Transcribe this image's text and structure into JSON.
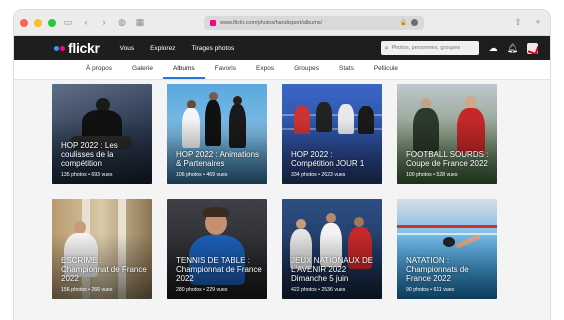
{
  "browser": {
    "url": "www.flickr.com/photos/handisport/albums/"
  },
  "header": {
    "logo_text": "flickr",
    "nav": [
      "Vous",
      "Explorez",
      "Tirages photos"
    ],
    "search_placeholder": "Photos, personnes, groupes"
  },
  "tabs": {
    "items": [
      "À propos",
      "Galerie",
      "Albums",
      "Favoris",
      "Expos",
      "Groupes",
      "Stats",
      "Pellicule"
    ],
    "active": "Albums"
  },
  "albums": [
    {
      "title": "HOP 2022 : Les coulisses de la compétition",
      "meta": "135 photos  •  693 vues"
    },
    {
      "title": "HOP 2022 : Animations & Partenaires",
      "meta": "106 photos  •  469 vues"
    },
    {
      "title": "HOP 2022 : Compétition JOUR 1",
      "meta": "334 photos  •  2623 vues"
    },
    {
      "title": "FOOTBALL SOURDS : Coupe de France 2022",
      "meta": "100 photos  •  528 vues"
    },
    {
      "title": "ESCRIME : Championnat de France 2022",
      "meta": "156 photos  •  266 vues"
    },
    {
      "title": "TENNIS DE TABLE : Championnat de France 2022",
      "meta": "280 photos  •  229 vues"
    },
    {
      "title": "JEUX NATIONAUX DE L'AVENIR 2022 Dimanche 5 juin",
      "meta": "422 photos  •  2536 vues"
    },
    {
      "title": "NATATION : Championnats de France 2022",
      "meta": "90 photos  •  611 vues"
    }
  ]
}
